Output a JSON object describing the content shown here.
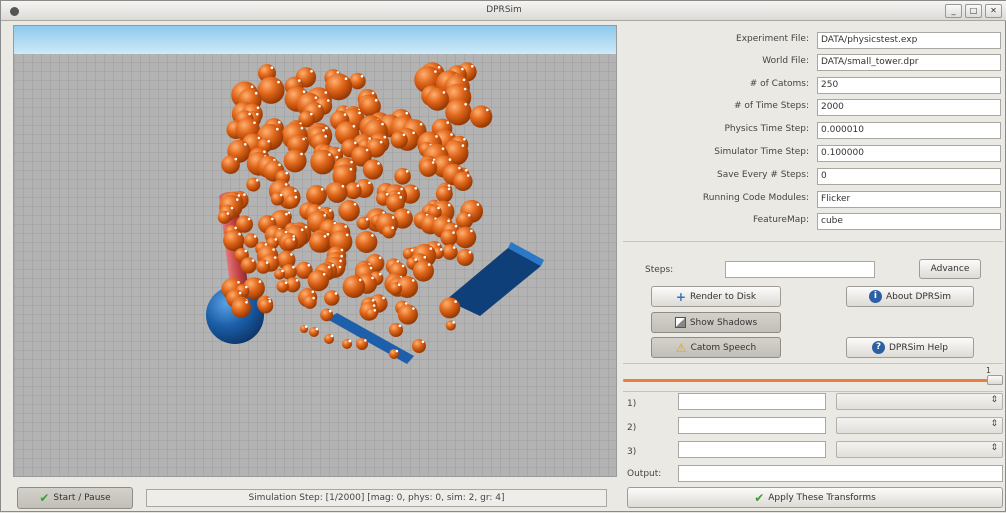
{
  "window": {
    "title": "DPRSim",
    "buttons": {
      "minimize": "_",
      "maximize": "□",
      "close": "✕"
    }
  },
  "config": [
    {
      "label": "Experiment File:",
      "value": "DATA/physicstest.exp"
    },
    {
      "label": "World File:",
      "value": "DATA/small_tower.dpr"
    },
    {
      "label": "# of Catoms:",
      "value": "250"
    },
    {
      "label": "# of Time Steps:",
      "value": "2000"
    },
    {
      "label": "Physics Time Step:",
      "value": "0.000010"
    },
    {
      "label": "Simulator Time Step:",
      "value": "0.100000"
    },
    {
      "label": "Save Every # Steps:",
      "value": "0"
    },
    {
      "label": "Running Code Modules:",
      "value": "Flicker"
    },
    {
      "label": "FeatureMap:",
      "value": "cube"
    }
  ],
  "controls": {
    "steps_label": "Steps:",
    "steps_value": "",
    "advance_label": "Advance",
    "render_label": "Render to Disk",
    "about_label": "About DPRSim",
    "shadows_label": "Show Shadows",
    "speech_label": "Catom Speech",
    "help_label": "DPRSim Help"
  },
  "slider": {
    "value_label": "1",
    "level": 1.0
  },
  "transforms": {
    "rows": [
      {
        "label": "1)"
      },
      {
        "label": "2)"
      },
      {
        "label": "3)"
      }
    ],
    "output_label": "Output:",
    "apply_label": "Apply These Transforms"
  },
  "bottom": {
    "start_label": "Start / Pause",
    "status_text": "Simulation Step: [1/2000] [mag: 0, phys: 0, sim: 2, gr: 4]"
  },
  "colors": {
    "catom": "#d9620f",
    "pole": "#c8474b",
    "base_sphere": "#1b5ea8",
    "sky": "#a9d9f1",
    "floor": "#b2b2b2"
  }
}
